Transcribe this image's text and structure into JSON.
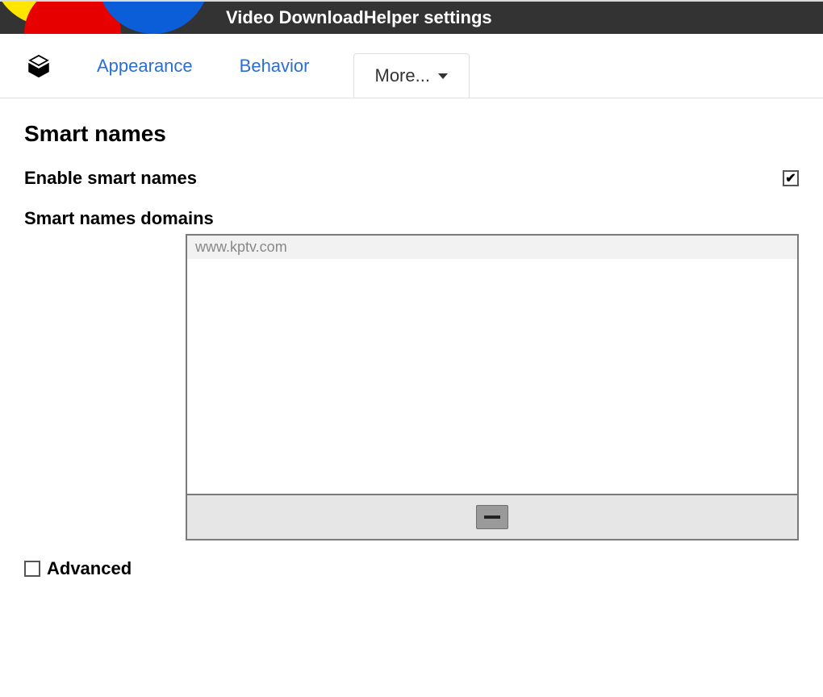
{
  "header": {
    "title": "Video DownloadHelper settings"
  },
  "tabs": {
    "appearance": "Appearance",
    "behavior": "Behavior",
    "more": "More..."
  },
  "section": {
    "title": "Smart names",
    "enable_label": "Enable smart names",
    "enable_checked": true,
    "domains_label": "Smart names domains",
    "domains": [
      "www.kptv.com"
    ]
  },
  "advanced": {
    "label": "Advanced",
    "checked": false
  }
}
